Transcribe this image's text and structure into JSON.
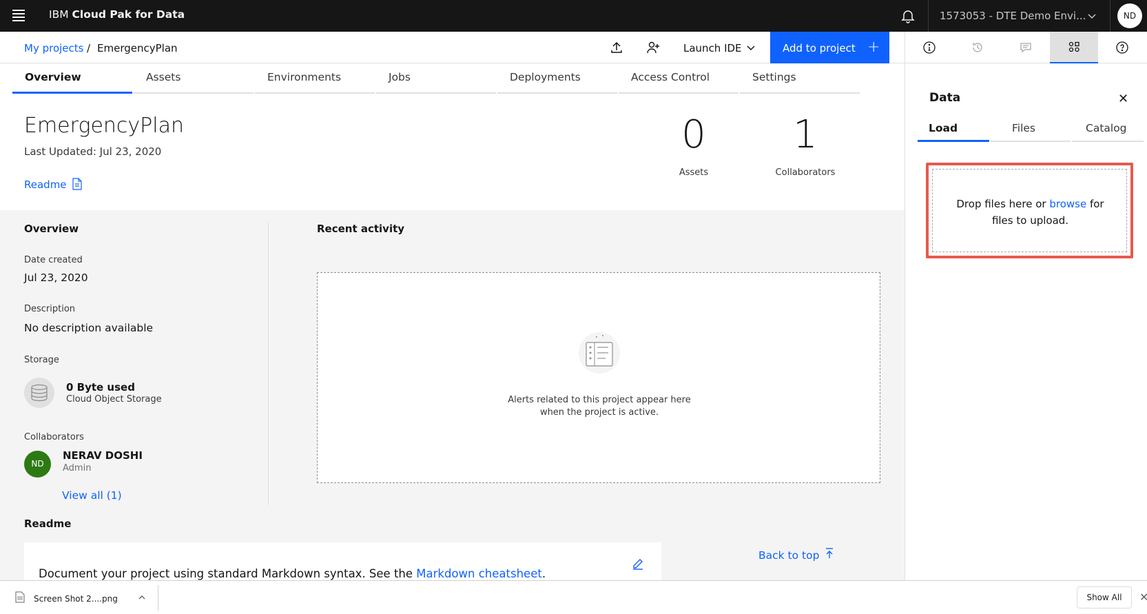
{
  "header": {
    "brand_prefix": "IBM",
    "brand_name": "Cloud Pak for Data",
    "account": "1573053 - DTE Demo Envi...",
    "avatar_initials": "ND"
  },
  "breadcrumb": {
    "parent": "My projects",
    "separator": "/",
    "current": "EmergencyPlan"
  },
  "toolbar": {
    "launch_ide": "Launch IDE",
    "add_to_project": "Add to project",
    "add_icon": "+"
  },
  "tabs": [
    "Overview",
    "Assets",
    "Environments",
    "Jobs",
    "Deployments",
    "Access Control",
    "Settings"
  ],
  "project": {
    "title": "EmergencyPlan",
    "last_updated": "Last Updated: Jul 23, 2020",
    "readme_link": "Readme",
    "stats": [
      {
        "value": "0",
        "label": "Assets"
      },
      {
        "value": "1",
        "label": "Collaborators"
      }
    ]
  },
  "overview": {
    "title": "Overview",
    "date_created_label": "Date created",
    "date_created": "Jul 23, 2020",
    "description_label": "Description",
    "description": "No description available",
    "storage_label": "Storage",
    "storage_used": "0 Byte used",
    "storage_type": "Cloud Object Storage",
    "collaborators_label": "Collaborators",
    "collaborator_initials": "ND",
    "collaborator_name": "NERAV DOSHI",
    "collaborator_role": "Admin",
    "view_all": "View all (1)"
  },
  "recent_activity": {
    "title": "Recent activity",
    "empty_line1": "Alerts related to this project appear here",
    "empty_line2": "when the project is active."
  },
  "readme": {
    "title": "Readme",
    "text": "Document your project using standard Markdown syntax. See the ",
    "link": "Markdown cheatsheet",
    "text_end": ".",
    "back_to_top": "Back to top"
  },
  "panel": {
    "title": "Data",
    "close": "✕",
    "tabs": [
      "Load",
      "Files",
      "Catalog"
    ],
    "drop_prefix": "Drop files here or ",
    "drop_link": "browse",
    "drop_suffix": " for",
    "drop_line2": "files to upload."
  },
  "downloads": {
    "file_name": "Screen Shot 2....png",
    "show_all": "Show All",
    "close": "✕"
  },
  "colors": {
    "accent": "#0f62fe",
    "header_bg": "#161616",
    "highlight_border": "#e8594f",
    "avatar_green": "#2d7a14"
  }
}
